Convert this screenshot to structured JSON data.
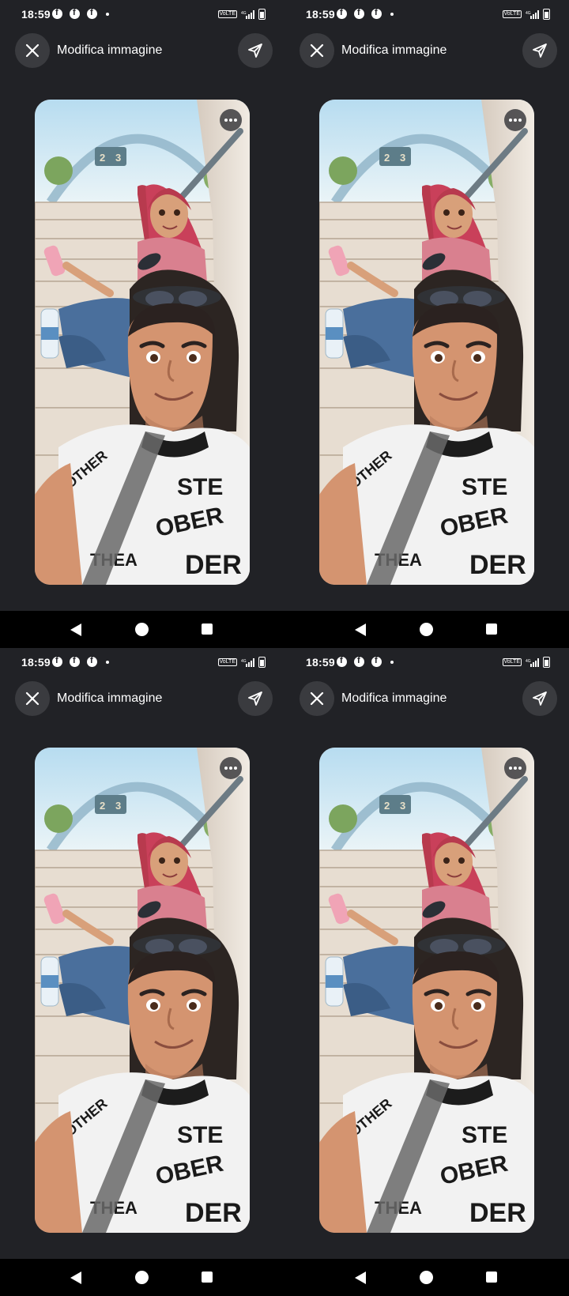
{
  "panels": [
    {
      "status": {
        "time": "18:59",
        "volte": "VoLTE"
      },
      "header": {
        "title": "Modifica immagine"
      }
    },
    {
      "status": {
        "time": "18:59",
        "volte": "VoLTE"
      },
      "header": {
        "title": "Modifica immagine"
      }
    },
    {
      "status": {
        "time": "18:59",
        "volte": "VoLTE"
      },
      "header": {
        "title": "Modifica immagine"
      }
    },
    {
      "status": {
        "time": "18:59",
        "volte": "VoLTE"
      },
      "header": {
        "title": "Modifica immagine"
      }
    }
  ],
  "icons": {
    "close": "close-icon",
    "send": "send-icon",
    "more": "more-options-icon",
    "notification": "facebook-icon",
    "nav_back": "back-icon",
    "nav_home": "home-icon",
    "nav_recent": "recent-apps-icon"
  },
  "colors": {
    "background": "#212226",
    "button": "#3a3b3f",
    "navbar": "#000000"
  }
}
